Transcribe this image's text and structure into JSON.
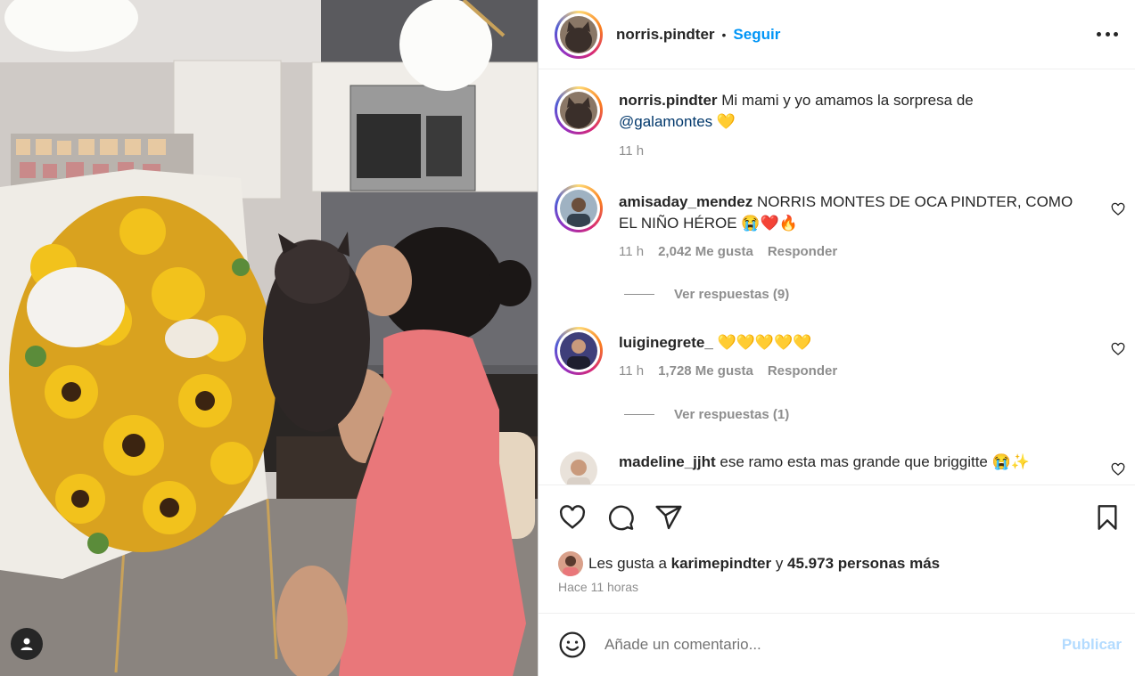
{
  "post": {
    "author": "norris.pindter",
    "separator": "•",
    "follow_label": "Seguir",
    "more_icon": "more-horizontal-icon"
  },
  "caption": {
    "username": "norris.pindter",
    "text": "Mi mami y yo amamos la sorpresa de",
    "mention": "@galamontes",
    "emoji": "💛",
    "time": "11 h"
  },
  "comments": [
    {
      "username": "amisaday_mendez",
      "text": "NORRIS MONTES DE OCA PINDTER, COMO EL NIÑO HÉROE 😭❤️🔥",
      "time": "11 h",
      "likes": "2,042 Me gusta",
      "reply_label": "Responder",
      "view_replies": "Ver respuestas (9)"
    },
    {
      "username": "luiginegrete_",
      "text": "💛💛💛💛💛",
      "time": "11 h",
      "likes": "1,728 Me gusta",
      "reply_label": "Responder",
      "view_replies": "Ver respuestas (1)"
    },
    {
      "username": "madeline_jjht",
      "text": "ese ramo esta mas grande que briggitte 😭✨"
    }
  ],
  "likes_summary": {
    "prefix": "Les gusta a",
    "user": "karimepindter",
    "connector": "y",
    "count": "45.973 personas más"
  },
  "timestamp": "Hace 11 horas",
  "add_comment": {
    "placeholder": "Añade un comentario...",
    "post_label": "Publicar"
  },
  "colors": {
    "accent": "#0095f6",
    "mention": "#00376b",
    "muted": "#8e8e8e",
    "post_disabled": "#b3dbff"
  }
}
